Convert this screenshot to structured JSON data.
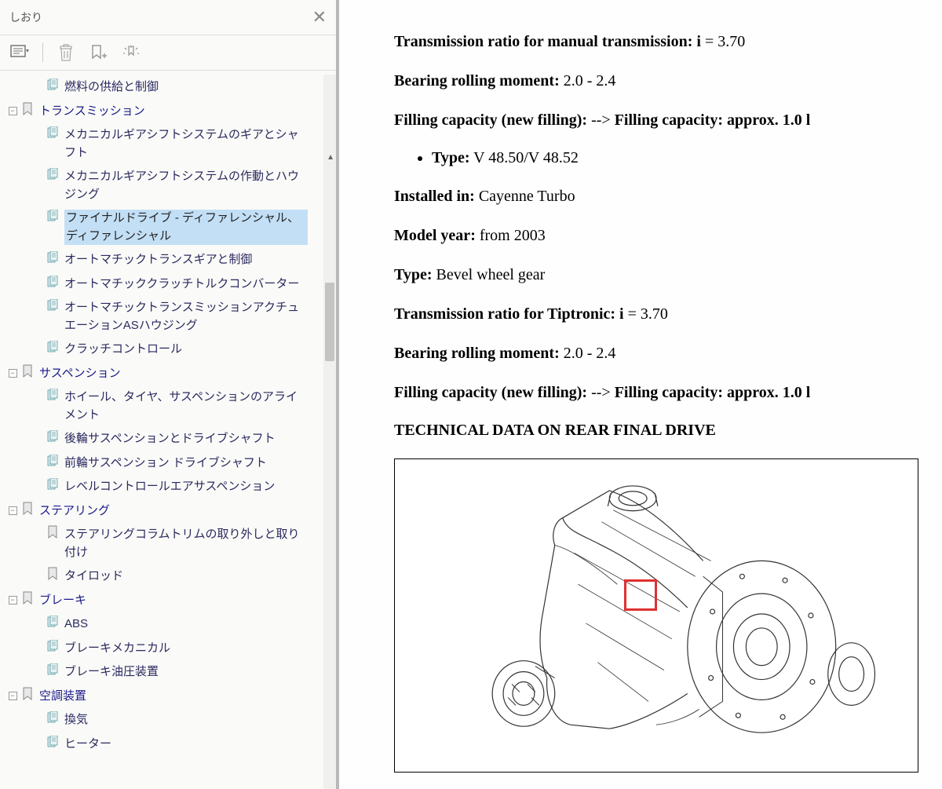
{
  "sidebar": {
    "title": "しおり",
    "tree": [
      {
        "level": 2,
        "icon": "page",
        "label": "燃料の供給と制御",
        "heading": false,
        "selected": false,
        "expandable": false
      },
      {
        "level": 1,
        "icon": "ribbon",
        "label": "トランスミッション",
        "heading": true,
        "selected": false,
        "expandable": true
      },
      {
        "level": 2,
        "icon": "page",
        "label": "メカニカルギアシフトシステムのギアとシャフト",
        "heading": false,
        "selected": false,
        "expandable": false
      },
      {
        "level": 2,
        "icon": "page",
        "label": "メカニカルギアシフトシステムの作動とハウジング",
        "heading": false,
        "selected": false,
        "expandable": false
      },
      {
        "level": 2,
        "icon": "page",
        "label": "ファイナルドライブ - ディファレンシャル、ディファレンシャル",
        "heading": false,
        "selected": true,
        "expandable": false
      },
      {
        "level": 2,
        "icon": "page",
        "label": "オートマチックトランスギアと制御",
        "heading": false,
        "selected": false,
        "expandable": false
      },
      {
        "level": 2,
        "icon": "page",
        "label": "オートマチッククラッチトルクコンバーター",
        "heading": false,
        "selected": false,
        "expandable": false
      },
      {
        "level": 2,
        "icon": "page",
        "label": "オートマチックトランスミッションアクチュエーションASハウジング",
        "heading": false,
        "selected": false,
        "expandable": false
      },
      {
        "level": 2,
        "icon": "page",
        "label": "クラッチコントロール",
        "heading": false,
        "selected": false,
        "expandable": false
      },
      {
        "level": 1,
        "icon": "ribbon",
        "label": "サスペンション",
        "heading": true,
        "selected": false,
        "expandable": true
      },
      {
        "level": 2,
        "icon": "page",
        "label": "ホイール、タイヤ、サスペンションのアライメント",
        "heading": false,
        "selected": false,
        "expandable": false
      },
      {
        "level": 2,
        "icon": "page",
        "label": "後輪サスペンションとドライブシャフト",
        "heading": false,
        "selected": false,
        "expandable": false
      },
      {
        "level": 2,
        "icon": "page",
        "label": "前輪サスペンション ドライブシャフト",
        "heading": false,
        "selected": false,
        "expandable": false
      },
      {
        "level": 2,
        "icon": "page",
        "label": "レベルコントロールエアサスペンション",
        "heading": false,
        "selected": false,
        "expandable": false
      },
      {
        "level": 1,
        "icon": "ribbon",
        "label": "ステアリング",
        "heading": true,
        "selected": false,
        "expandable": true
      },
      {
        "level": 2,
        "icon": "ribbon",
        "label": "ステアリングコラムトリムの取り外しと取り付け",
        "heading": false,
        "selected": false,
        "expandable": false
      },
      {
        "level": 2,
        "icon": "ribbon",
        "label": "タイロッド",
        "heading": false,
        "selected": false,
        "expandable": false
      },
      {
        "level": 1,
        "icon": "ribbon",
        "label": "ブレーキ",
        "heading": true,
        "selected": false,
        "expandable": true
      },
      {
        "level": 2,
        "icon": "page",
        "label": "ABS",
        "heading": false,
        "selected": false,
        "expandable": false
      },
      {
        "level": 2,
        "icon": "page",
        "label": "ブレーキメカニカル",
        "heading": false,
        "selected": false,
        "expandable": false
      },
      {
        "level": 2,
        "icon": "page",
        "label": "ブレーキ油圧装置",
        "heading": false,
        "selected": false,
        "expandable": false
      },
      {
        "level": 1,
        "icon": "ribbon",
        "label": "空調装置",
        "heading": true,
        "selected": false,
        "expandable": true
      },
      {
        "level": 2,
        "icon": "page",
        "label": "換気",
        "heading": false,
        "selected": false,
        "expandable": false
      },
      {
        "level": 2,
        "icon": "page",
        "label": "ヒーター",
        "heading": false,
        "selected": false,
        "expandable": false
      }
    ]
  },
  "content": {
    "p1_label": "Transmission ratio for manual transmission: i",
    "p1_value": " = 3.70",
    "p2_label": "Bearing rolling moment:",
    "p2_value": " 2.0 - 2.4",
    "p3_label": "Filling capacity (new filling):",
    "p3_mid": " --> ",
    "p3_label2": "Filling capacity: approx. 1.0 l",
    "li1_label": "Type:",
    "li1_value": " V 48.50/V 48.52",
    "p4_label": "Installed in:",
    "p4_value": " Cayenne Turbo",
    "p5_label": "Model year:",
    "p5_value": " from 2003",
    "p6_label": "Type:",
    "p6_value": " Bevel wheel gear",
    "p7_label": "Transmission ratio for Tiptronic: i",
    "p7_value": " = 3.70",
    "p8_label": "Bearing rolling moment:",
    "p8_value": " 2.0 - 2.4",
    "p9_label": "Filling capacity (new filling):",
    "p9_mid": " --> ",
    "p9_label2": "Filling capacity: approx. 1.0 l",
    "heading": "TECHNICAL DATA ON REAR FINAL DRIVE"
  }
}
